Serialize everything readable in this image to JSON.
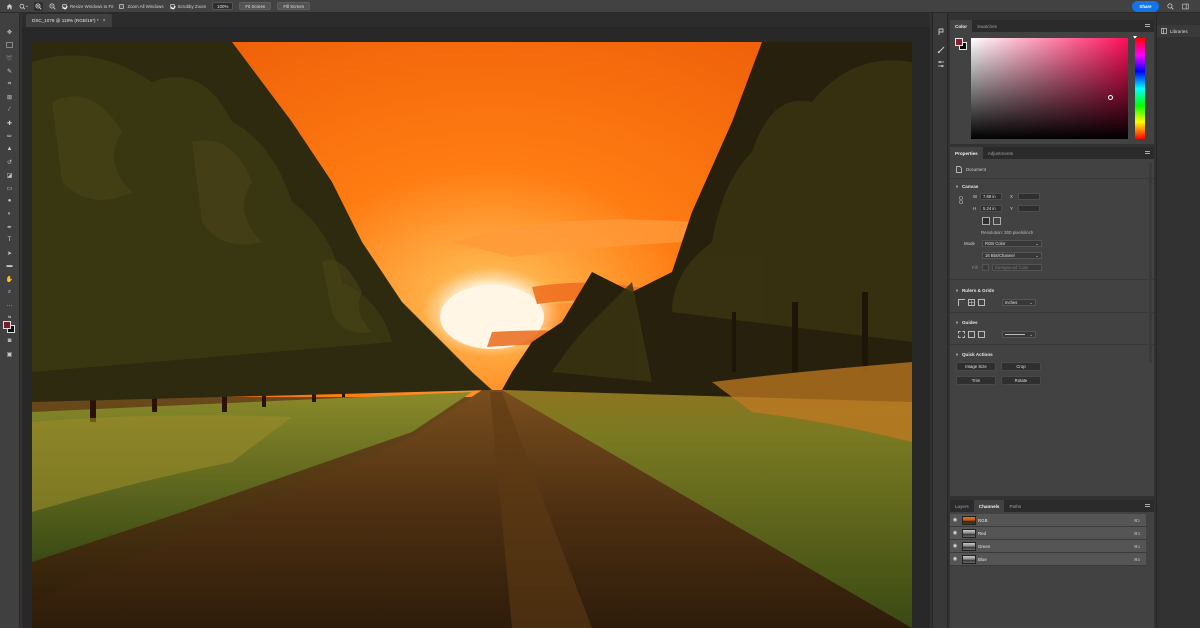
{
  "options_bar": {
    "home_icon": "home-icon",
    "zoom_tool_icon": "zoom-icon",
    "zoom_in_icon": "zoom-in-icon",
    "zoom_out_icon": "zoom-out-icon",
    "resize_windows_label": "Resize Windows to Fit",
    "resize_windows_checked": true,
    "zoom_all_windows_label": "Zoom All Windows",
    "zoom_all_windows_checked": false,
    "scrubby_zoom_label": "Scrubby Zoom",
    "scrubby_zoom_checked": true,
    "zoom_value": "100%",
    "fit_screen_label": "Fit Screen",
    "fill_screen_label": "Fill Screen",
    "share_label": "Share"
  },
  "document_tab": {
    "title": "DSC_1078 @ 119% (RGB/16*) *",
    "close_icon": "close-icon"
  },
  "color_panel": {
    "tabs": [
      "Color",
      "Swatches"
    ],
    "active_tab": "Color",
    "foreground_color": "#8a1f33",
    "background_color": "#0a0a0a",
    "hue_color": "#ff0f5a"
  },
  "properties_panel": {
    "tabs": [
      "Properties",
      "Adjustments"
    ],
    "active_tab": "Properties",
    "document_label": "Document",
    "canvas": {
      "section_label": "Canvas",
      "w_label": "W",
      "w_value": "7.88 in",
      "h_label": "H",
      "h_value": "5.24 in",
      "x_label": "X",
      "y_label": "Y",
      "resolution": "Resolution: 300 pixels/inch",
      "mode_label": "Mode",
      "mode_value": "RGB Color",
      "bit_depth_value": "16 Bits/Channel",
      "fill_label": "Fill",
      "fill_value": "Background Color"
    },
    "rulers_grids": {
      "section_label": "Rulers & Grids",
      "units_value": "Inches"
    },
    "guides": {
      "section_label": "Guides"
    },
    "quick_actions": {
      "section_label": "Quick Actions",
      "buttons": [
        "Image Size",
        "Crop",
        "Trim",
        "Rotate"
      ]
    }
  },
  "layers_panel": {
    "tabs": [
      "Layers",
      "Channels",
      "Paths"
    ],
    "active_tab": "Channels",
    "channels": [
      {
        "name": "RGB",
        "shortcut": "⌘2"
      },
      {
        "name": "Red",
        "shortcut": "⌘3"
      },
      {
        "name": "Green",
        "shortcut": "⌘4"
      },
      {
        "name": "Blue",
        "shortcut": "⌘5"
      }
    ]
  },
  "libraries": {
    "label": "Libraries"
  }
}
